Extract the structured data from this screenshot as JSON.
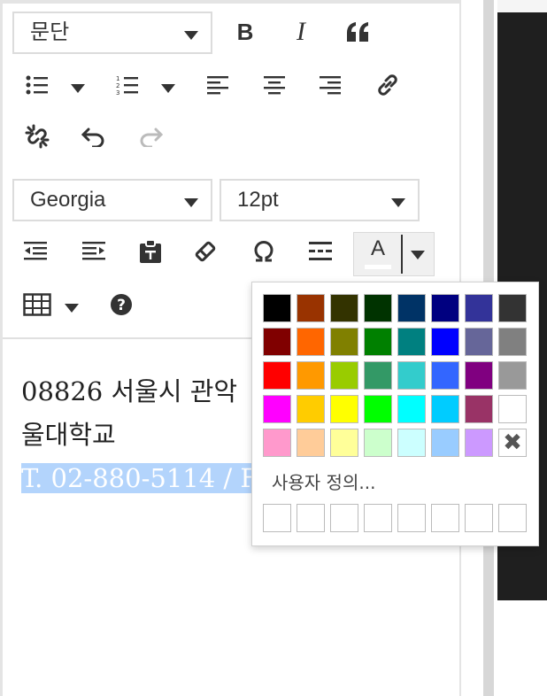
{
  "toolbar": {
    "format_select": "문단",
    "font_family_select": "Georgia",
    "font_size_select": "12pt",
    "bold_label": "B",
    "italic_label": "I",
    "text_color_letter": "A"
  },
  "content": {
    "line1": "08826 서울시 관악",
    "line2": "울대학교",
    "line3": "T. 02-880-5114 / F"
  },
  "color_palette": {
    "rows": [
      [
        "#000000",
        "#993300",
        "#333300",
        "#003300",
        "#003366",
        "#000080",
        "#333399",
        "#333333"
      ],
      [
        "#800000",
        "#FF6600",
        "#808000",
        "#008000",
        "#008080",
        "#0000FF",
        "#666699",
        "#808080"
      ],
      [
        "#FF0000",
        "#FF9900",
        "#99CC00",
        "#339966",
        "#33CCCC",
        "#3366FF",
        "#800080",
        "#999999"
      ],
      [
        "#FF00FF",
        "#FFCC00",
        "#FFFF00",
        "#00FF00",
        "#00FFFF",
        "#00CCFF",
        "#993366",
        "#FFFFFF"
      ],
      [
        "#FF99CC",
        "#FFCC99",
        "#FFFF99",
        "#CCFFCC",
        "#CCFFFF",
        "#99CCFF",
        "#CC99FF",
        "remove"
      ]
    ],
    "custom_label": "사용자 정의...",
    "remove_symbol": "✖"
  }
}
